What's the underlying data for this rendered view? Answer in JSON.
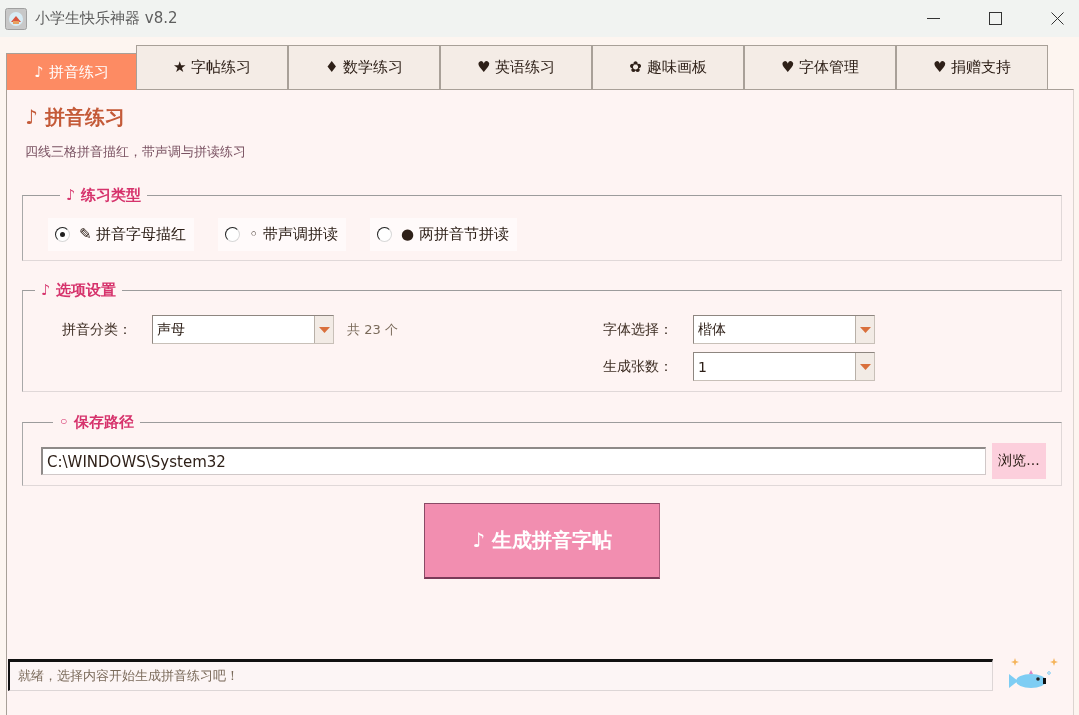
{
  "window": {
    "title": "小学生快乐神器 v8.2"
  },
  "tabs": [
    {
      "label": "♪ 拼音练习",
      "selected": true
    },
    {
      "label": "★ 字帖练习",
      "selected": false
    },
    {
      "label": "♦ 数学练习",
      "selected": false
    },
    {
      "label": "♥ 英语练习",
      "selected": false
    },
    {
      "label": "✿ 趣味画板",
      "selected": false
    },
    {
      "label": "♥ 字体管理",
      "selected": false
    },
    {
      "label": "♥ 捐赠支持",
      "selected": false
    }
  ],
  "page": {
    "heading": "♪ 拼音练习",
    "subtitle": "四线三格拼音描红，带声调与拼读练习"
  },
  "practice_type": {
    "legend": "♪ 练习类型",
    "options": [
      {
        "label": "✎ 拼音字母描红",
        "selected": true
      },
      {
        "label": "◦ 带声调拼读",
        "selected": false
      },
      {
        "label": "● 两拼音节拼读",
        "selected": false
      }
    ]
  },
  "settings": {
    "legend": "♪ 选项设置",
    "fields": [
      {
        "label": "拼音分类：",
        "value": "声母",
        "note": "共 23 个"
      },
      {
        "label": "字体选择：",
        "value": "楷体"
      },
      {
        "label": "生成张数：",
        "value": "1"
      }
    ]
  },
  "save_path": {
    "legend": "◦ 保存路径",
    "value": "C:\\WINDOWS\\System32",
    "browse_button": "浏览..."
  },
  "generate_button": "♪ 生成拼音字帖",
  "status_bar": {
    "text": "就绪，选择内容开始生成拼音练习吧！"
  }
}
